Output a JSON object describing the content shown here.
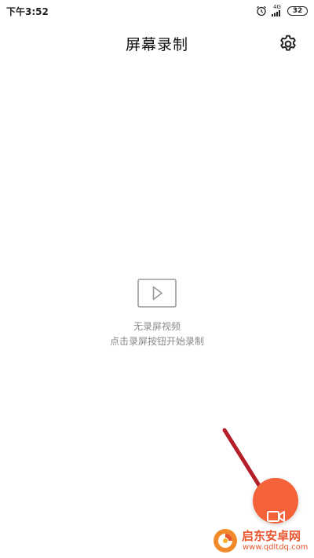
{
  "status_bar": {
    "time": "下午3:52",
    "network": "4G",
    "battery": "32",
    "icons": [
      "alarm-icon",
      "signal-icon",
      "battery-icon"
    ]
  },
  "header": {
    "title": "屏幕录制",
    "settings_icon": "gear-icon"
  },
  "empty_state": {
    "icon": "video-play-icon",
    "line1": "无录屏视频",
    "line2": "点击录屏按钮开始录制"
  },
  "fab": {
    "icon": "video-camera-icon",
    "color": "#f4623a"
  },
  "annotation": {
    "arrow_color": "#b3202a"
  },
  "watermark": {
    "name": "启东安卓网",
    "url": "www.qdltdq.com",
    "color": "#e8542d"
  }
}
